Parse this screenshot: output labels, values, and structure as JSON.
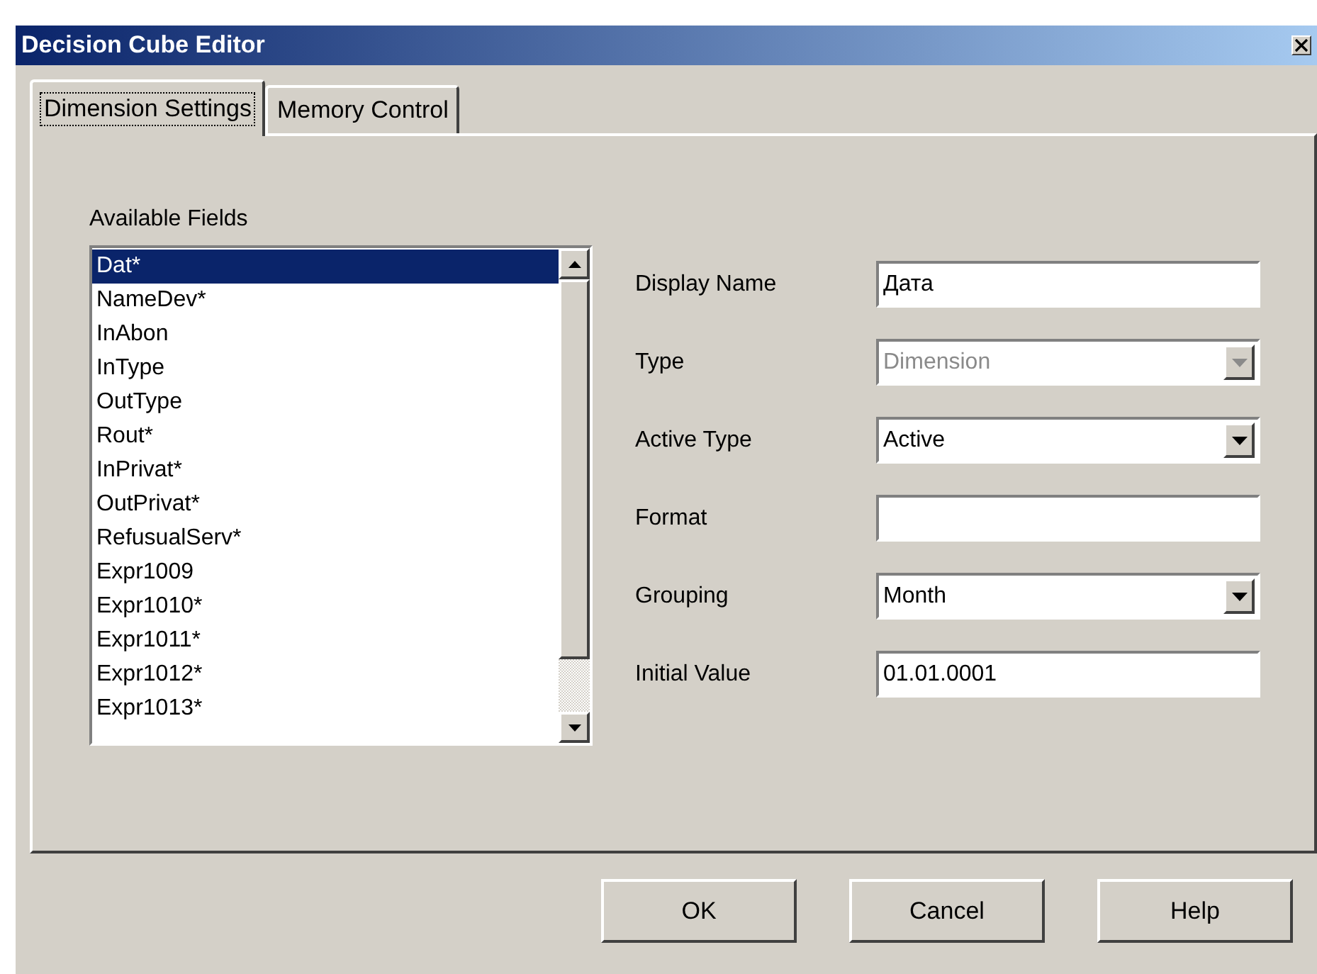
{
  "window": {
    "title": "Decision Cube Editor"
  },
  "tabs": [
    {
      "label": "Dimension Settings",
      "selected": true
    },
    {
      "label": "Memory Control",
      "selected": false
    }
  ],
  "available_fields": {
    "label": "Available Fields",
    "items": [
      {
        "label": "Dat*",
        "selected": true
      },
      {
        "label": "NameDev*",
        "selected": false
      },
      {
        "label": "InAbon",
        "selected": false
      },
      {
        "label": "InType",
        "selected": false
      },
      {
        "label": "OutType",
        "selected": false
      },
      {
        "label": "Rout*",
        "selected": false
      },
      {
        "label": "InPrivat*",
        "selected": false
      },
      {
        "label": "OutPrivat*",
        "selected": false
      },
      {
        "label": "RefusualServ*",
        "selected": false
      },
      {
        "label": "Expr1009",
        "selected": false
      },
      {
        "label": "Expr1010*",
        "selected": false
      },
      {
        "label": "Expr1011*",
        "selected": false
      },
      {
        "label": "Expr1012*",
        "selected": false
      },
      {
        "label": "Expr1013*",
        "selected": false
      }
    ]
  },
  "fields": [
    {
      "label": "Display Name",
      "kind": "text",
      "value": "Дата",
      "disabled": false
    },
    {
      "label": "Type",
      "kind": "combo",
      "value": "Dimension",
      "disabled": true
    },
    {
      "label": "Active Type",
      "kind": "combo",
      "value": "Active",
      "disabled": false
    },
    {
      "label": "Format",
      "kind": "text",
      "disabled": false
    },
    {
      "label": "Grouping",
      "kind": "combo",
      "value": "Month",
      "disabled": false
    },
    {
      "label": "Initial Value",
      "kind": "text",
      "value": "01.01.0001",
      "disabled": false
    }
  ],
  "buttons": [
    "OK",
    "Cancel",
    "Help"
  ]
}
